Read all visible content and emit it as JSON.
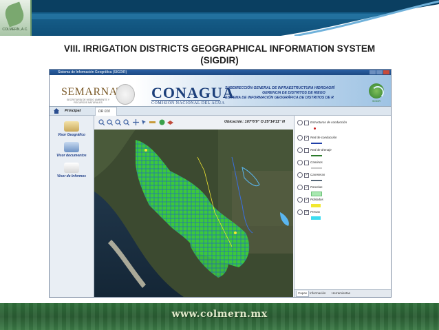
{
  "slide": {
    "title_line1": "VIII. IRRIGATION DISTRICTS GEOGRAPHICAL INFORMATION SYSTEM",
    "title_line2": "(SIGDIR)",
    "footer_url": "www.colmern.mx",
    "corner_logo_text": "COLMERN, A.C."
  },
  "window": {
    "title": "Sistema de Información Geográfica (SIGDIR)"
  },
  "banner": {
    "semarnat": "SEMARNAT",
    "semarnat_sub": "SECRETARÍA DE MEDIO AMBIENTE Y RECURSOS NATURALES",
    "conagua": "CONAGUA",
    "conagua_sub": "COMISIÓN NACIONAL DEL AGUA",
    "line1": "SUBDIRECCIÓN GENERAL DE INFRAESTRUCTURA HIDROAGRÍ",
    "line2": "GERENCIA DE DISTRITOS DE RIEGO",
    "line3": "SISTEMA DE INFORMACIÓN GEOGRÁFICA DE DISTRITOS DE R",
    "logo_text": "SIGDIR"
  },
  "tabs": {
    "principal": "Principal",
    "dr": "DR 010"
  },
  "sidebar": {
    "items": [
      {
        "label": "Visor Geográfico"
      },
      {
        "label": "Visor documentos"
      },
      {
        "label": "Visor de Informes"
      }
    ]
  },
  "toolbar": {
    "location_label": "Ubicación: 107°6'9'' O   25°14'11'' N"
  },
  "layers": {
    "items": [
      {
        "label": "Estructuras de conducción",
        "checked": false
      },
      {
        "label": "Red de conducción",
        "checked": true
      },
      {
        "label": "Red de drenaje",
        "checked": false
      },
      {
        "label": "Caminos",
        "checked": false
      },
      {
        "label": "Carreteras",
        "checked": true
      },
      {
        "label": "Parcelas",
        "checked": true
      },
      {
        "label": "Poblados",
        "checked": true
      },
      {
        "label": "Presas",
        "checked": true
      }
    ],
    "swatch_colors": [
      "#cc2222",
      "#1f3fa8",
      "#2a7a2a",
      "#c8c8c8",
      "#556677",
      "#a8e8b0",
      "#f2e830",
      "#3cdcf0"
    ]
  },
  "panel_tabs": [
    "Capas",
    "Información",
    "Herramientas"
  ],
  "colors": {
    "header_blue": "#1b6a98",
    "footer_green": "#2f6f3a",
    "conagua_blue": "#1c3f7a",
    "parcel_green": "#3cc83c"
  }
}
